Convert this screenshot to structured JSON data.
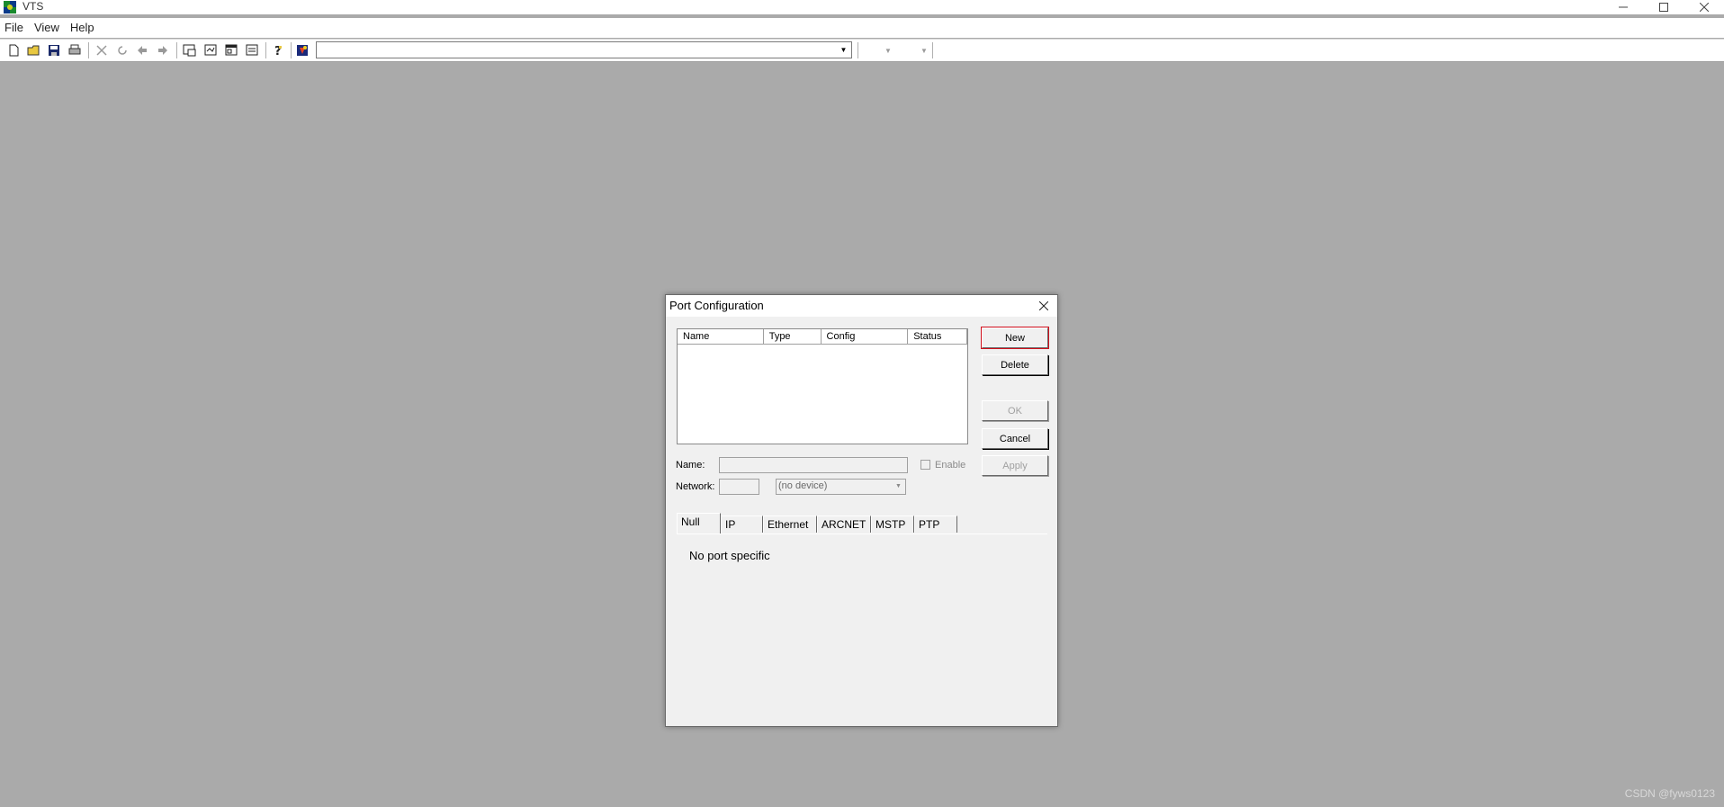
{
  "window": {
    "title": "VTS",
    "controls": [
      "minimize-icon",
      "maximize-icon",
      "close-icon"
    ]
  },
  "menu": {
    "items": [
      "File",
      "View",
      "Help"
    ]
  },
  "toolbar": {
    "icons": [
      "new-file-icon",
      "open-folder-icon",
      "save-icon",
      "print-icon",
      "delete-icon",
      "undo-icon",
      "back-icon",
      "forward-icon",
      "window-icon",
      "graph-icon",
      "panel-icon",
      "list-icon",
      "help-icon",
      "special-icon"
    ],
    "combo_value": ""
  },
  "dialog": {
    "title": "Port Configuration",
    "list": {
      "columns": [
        "Name",
        "Type",
        "Config",
        "Status"
      ],
      "rows": []
    },
    "buttons": {
      "new": "New",
      "delete": "Delete",
      "ok": "OK",
      "cancel": "Cancel",
      "apply": "Apply"
    },
    "fields": {
      "name_label": "Name:",
      "name_value": "",
      "enable_label": "Enable",
      "network_label": "Network:",
      "network_value": "",
      "device_value": "(no device)"
    },
    "tabs": [
      "Null",
      "IP",
      "Ethernet",
      "ARCNET",
      "MSTP",
      "PTP"
    ],
    "active_tab": "Null",
    "panel_text": "No port specific"
  },
  "watermark": "CSDN @fyws0123",
  "colors": {
    "desktop": "#aaaaaa",
    "dialog_bg": "#f0f0f0",
    "highlight": "#d0101c"
  }
}
